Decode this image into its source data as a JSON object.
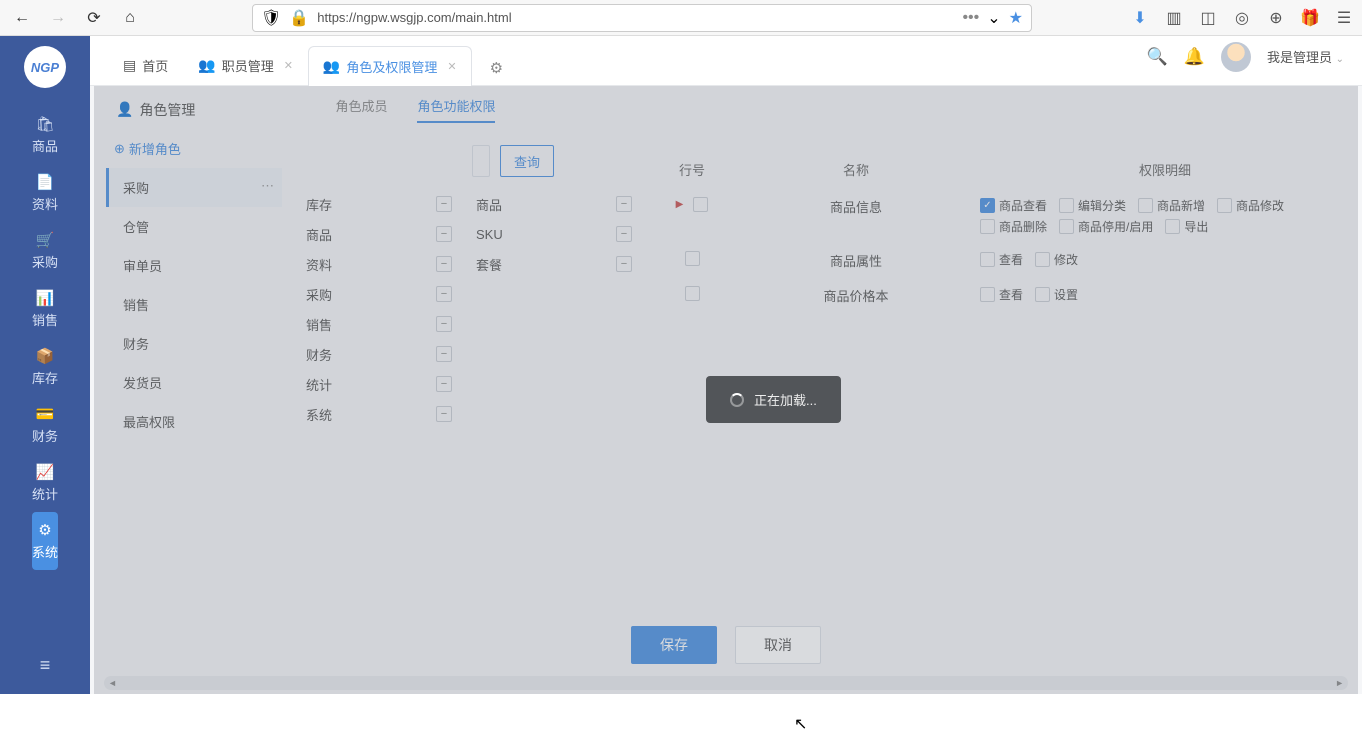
{
  "browser": {
    "url": "https://ngpw.wsgjp.com/main.html"
  },
  "logo": "NGP",
  "sidebar": {
    "items": [
      {
        "label": "商品",
        "icon": "🛍"
      },
      {
        "label": "资料",
        "icon": "📄"
      },
      {
        "label": "采购",
        "icon": "🛒"
      },
      {
        "label": "销售",
        "icon": "📊"
      },
      {
        "label": "库存",
        "icon": "📦"
      },
      {
        "label": "财务",
        "icon": "💳"
      },
      {
        "label": "统计",
        "icon": "📈"
      },
      {
        "label": "系统",
        "icon": "⚙"
      }
    ],
    "active_index": 7
  },
  "tabs": {
    "items": [
      {
        "label": "首页",
        "closable": false
      },
      {
        "label": "职员管理",
        "closable": true
      },
      {
        "label": "角色及权限管理",
        "closable": true
      }
    ],
    "active_index": 2
  },
  "user": {
    "name": "我是管理员"
  },
  "page": {
    "title": "角色管理",
    "subtabs": [
      "角色成员",
      "角色功能权限"
    ],
    "subtab_active": 1,
    "new_role": "新增角色",
    "roles": [
      "采购",
      "仓管",
      "审单员",
      "销售",
      "财务",
      "发货员",
      "最高权限"
    ],
    "role_selected": 0,
    "categories": [
      "库存",
      "商品",
      "资料",
      "采购",
      "销售",
      "财务",
      "统计",
      "系统"
    ],
    "sub_items": [
      "商品",
      "SKU",
      "套餐"
    ],
    "search_placeholder": "",
    "query_btn": "查询",
    "table": {
      "headers": [
        "行号",
        "名称",
        "权限明细"
      ],
      "rows": [
        {
          "name": "商品信息",
          "marker": true,
          "perms": [
            {
              "label": "商品查看",
              "checked": true
            },
            {
              "label": "编辑分类",
              "checked": false
            },
            {
              "label": "商品新增",
              "checked": false
            },
            {
              "label": "商品修改",
              "checked": false
            },
            {
              "label": "商品删除",
              "checked": false
            },
            {
              "label": "商品停用/启用",
              "checked": false
            },
            {
              "label": "导出",
              "checked": false
            }
          ]
        },
        {
          "name": "商品属性",
          "perms": [
            {
              "label": "查看",
              "checked": false
            },
            {
              "label": "修改",
              "checked": false
            }
          ]
        },
        {
          "name": "商品价格本",
          "perms": [
            {
              "label": "查看",
              "checked": false
            },
            {
              "label": "设置",
              "checked": false
            }
          ]
        }
      ]
    },
    "save_btn": "保存",
    "cancel_btn": "取消"
  },
  "loading_text": "正在加载..."
}
